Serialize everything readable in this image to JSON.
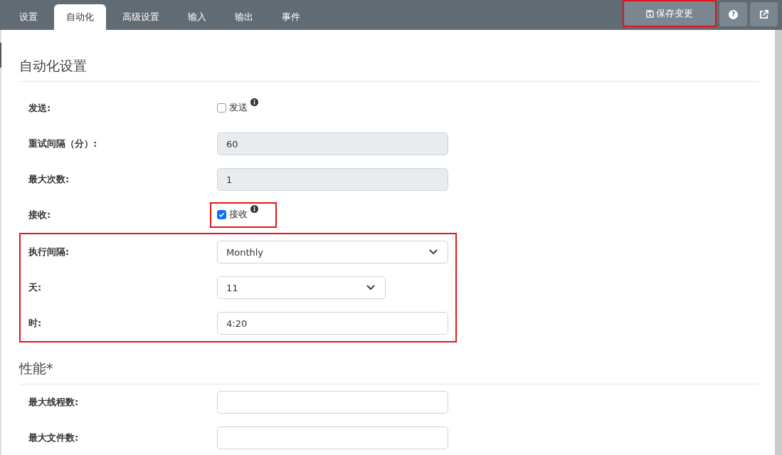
{
  "tabs": [
    {
      "label": "设置",
      "selected": false
    },
    {
      "label": "自动化",
      "selected": true
    },
    {
      "label": "高级设置",
      "selected": false
    },
    {
      "label": "输入",
      "selected": false
    },
    {
      "label": "输出",
      "selected": false
    },
    {
      "label": "事件",
      "selected": false
    }
  ],
  "save_button": {
    "label": "保存变更",
    "highlighted": true
  },
  "help_button": {
    "label": "?"
  },
  "sections": [
    {
      "title": "自动化设置",
      "rows": [
        {
          "kind": "checkbox",
          "label": "发送:",
          "text": "发送",
          "checked": false,
          "highlighted": false
        },
        {
          "kind": "readonly",
          "label": "重试间隔（分）:",
          "value": "60"
        },
        {
          "kind": "readonly",
          "label": "最大次数:",
          "value": "1"
        },
        {
          "kind": "checkbox",
          "label": "接收:",
          "text": "接收",
          "checked": true,
          "highlighted": true
        },
        {
          "kind": "group",
          "highlighted": true,
          "rows": [
            {
              "kind": "select",
              "label": "执行间隔:",
              "value": "Monthly",
              "wide": true
            },
            {
              "kind": "select",
              "label": "天:",
              "value": "11",
              "wide": false
            },
            {
              "kind": "input",
              "label": "时:",
              "value": "4:20"
            }
          ]
        }
      ]
    },
    {
      "title": "性能*",
      "rows": [
        {
          "kind": "input",
          "label": "最大线程数:"
        },
        {
          "kind": "input",
          "label": "最大文件数:"
        }
      ]
    }
  ]
}
